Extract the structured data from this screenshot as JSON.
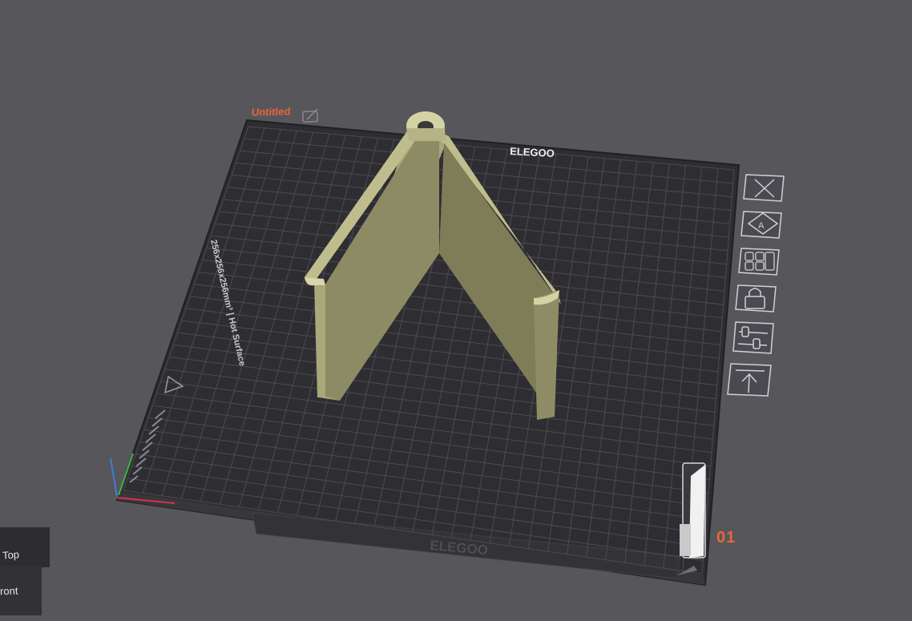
{
  "plate": {
    "name": "Untitled",
    "brand": "ELEGOO",
    "size_label": "256x256x256mm³ | Hot Surface",
    "plate_number": "01"
  },
  "view_cube": {
    "top_label": "Top",
    "front_label": "ront"
  },
  "toolbar": {
    "buttons": [
      {
        "name": "remove-plate",
        "icon": "close-icon"
      },
      {
        "name": "auto-orient",
        "icon": "auto-orient-icon"
      },
      {
        "name": "arrange",
        "icon": "arrange-icon"
      },
      {
        "name": "lock-plate",
        "icon": "lock-icon"
      },
      {
        "name": "plate-settings",
        "icon": "sliders-icon"
      },
      {
        "name": "move-to-top",
        "icon": "move-top-icon"
      }
    ]
  },
  "colors": {
    "background": "#57565b",
    "plate": "#2e2d32",
    "grid": "#4a4950",
    "model": "#c9c997",
    "accent": "#e8663a"
  }
}
